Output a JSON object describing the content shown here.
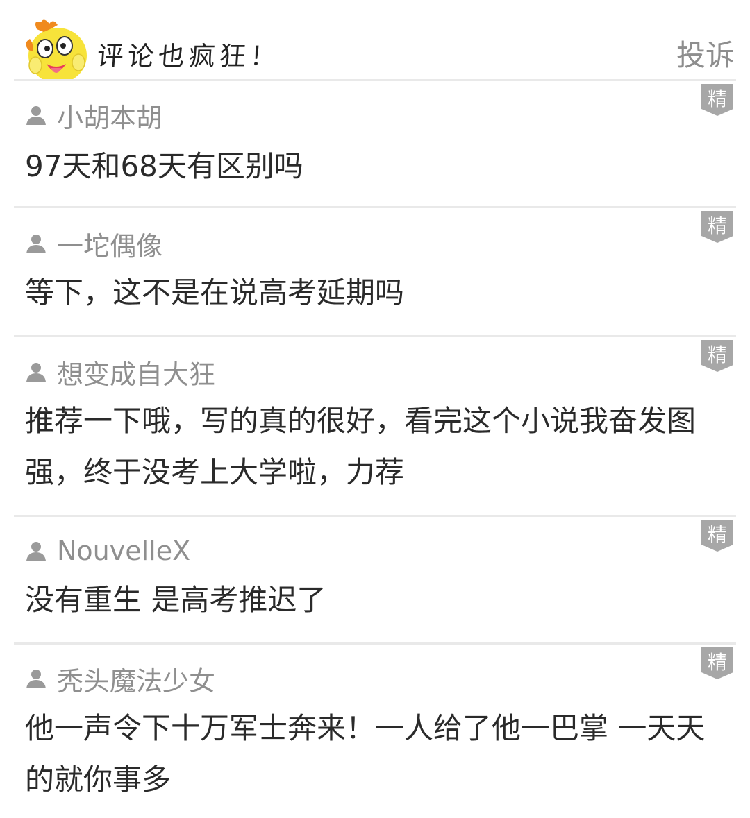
{
  "header": {
    "title": "评论也疯狂！",
    "report_label": "投诉"
  },
  "badge_label": "精",
  "comments": [
    {
      "username": "小胡本胡",
      "text": "97天和68天有区别吗"
    },
    {
      "username": "一坨偶像",
      "text": "等下，这不是在说高考延期吗"
    },
    {
      "username": "想变成自大狂",
      "text": "推荐一下哦，写的真的很好，看完这个小说我奋发图强，终于没考上大学啦，力荐"
    },
    {
      "username": "NouvelleX",
      "text": "没有重生 是高考推迟了"
    },
    {
      "username": "秃头魔法少女",
      "text": "他一声令下十万军士奔来！一人给了他一巴掌 一天天的就你事多"
    }
  ],
  "colors": {
    "username": "#8f8f8f",
    "text": "#2a2a2a",
    "divider": "#e9e9e9",
    "badge": "#a7a7a7",
    "mascot_yellow": "#f7e33a"
  }
}
